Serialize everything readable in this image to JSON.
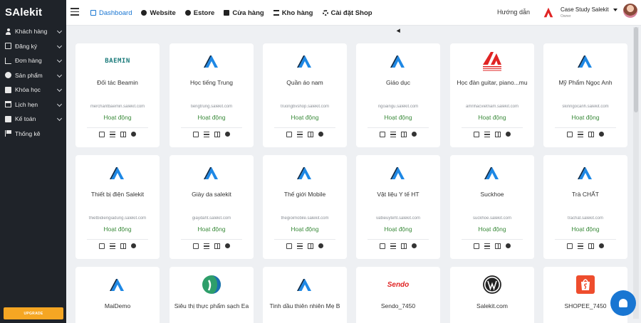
{
  "sidebar": {
    "brand": "SAlekit",
    "items": [
      {
        "label": "Khách hàng",
        "icon": "user-icon"
      },
      {
        "label": "Đăng ký",
        "icon": "register-icon"
      },
      {
        "label": "Đơn hàng",
        "icon": "cart-icon"
      },
      {
        "label": "Sản phẩm",
        "icon": "product-icon"
      },
      {
        "label": "Khóa học",
        "icon": "book-icon"
      },
      {
        "label": "Lịch hẹn",
        "icon": "calendar-icon"
      },
      {
        "label": "Kế toán",
        "icon": "calculator-icon"
      },
      {
        "label": "Thống kê",
        "icon": "flag-icon"
      }
    ],
    "upgrade_label": "UPGRADE"
  },
  "topbar": {
    "nav": [
      {
        "label": "Dashboard",
        "icon": "monitor-icon",
        "active": true
      },
      {
        "label": "Website",
        "icon": "globe-icon"
      },
      {
        "label": "Estore",
        "icon": "globe-icon"
      },
      {
        "label": "Cửa hàng",
        "icon": "store-icon"
      },
      {
        "label": "Kho hàng",
        "icon": "stack-icon"
      },
      {
        "label": "Cài đặt Shop",
        "icon": "gear-icon"
      }
    ],
    "guide": "Hướng dẫn",
    "account_name": "Case Study Salekit",
    "account_role": "Owner"
  },
  "colors": {
    "accent": "#1976d2",
    "status_green": "#3a8a3a",
    "sidebar_bg": "#1f2329",
    "upgrade": "#f5a623"
  },
  "cards": [
    {
      "name": "Đối tác Beamin",
      "domain": "merchantbaemin.salekit.com",
      "status": "Hoạt động",
      "logo": "beamin"
    },
    {
      "name": "Học tiếng Trung",
      "domain": "tiengtrung.salekit.com",
      "status": "Hoạt động",
      "logo": "salekit"
    },
    {
      "name": "Quần áo nam",
      "domain": "truongbvshop.salekit.com",
      "status": "Hoạt động",
      "logo": "salekit"
    },
    {
      "name": "Giáo dục",
      "domain": "ngoaingu.salekit.com",
      "status": "Hoạt động",
      "logo": "salekit"
    },
    {
      "name": "Học đàn guitar, piano...mu",
      "domain": "amnhacvietnam.salekit.com",
      "status": "Hoạt động",
      "logo": "red-a"
    },
    {
      "name": "Mỹ Phẩm Ngọc Anh",
      "domain": "skinngocanh.salekit.com",
      "status": "Hoạt động",
      "logo": "salekit"
    },
    {
      "name": "Thiết bị điện Salekit",
      "domain": "thietbidiengiadung.salekit.com",
      "status": "Hoạt động",
      "logo": "salekit"
    },
    {
      "name": "Giày da salekit",
      "domain": "giaydaht.salekit.com",
      "status": "Hoạt động",
      "logo": "salekit"
    },
    {
      "name": "Thế giới Mobile",
      "domain": "thegioimobile.salekit.com",
      "status": "Hoạt động",
      "logo": "salekit"
    },
    {
      "name": "Vật liệu Y tế HT",
      "domain": "vatlieuyteht.salekit.com",
      "status": "Hoạt động",
      "logo": "salekit"
    },
    {
      "name": "Suckhoe",
      "domain": "suckhoe.salekit.com",
      "status": "Hoạt động",
      "logo": "salekit"
    },
    {
      "name": "Trà CHẤT",
      "domain": "trachat.salekit.com",
      "status": "Hoạt động",
      "logo": "salekit"
    },
    {
      "name": "MaiDemo",
      "domain": "",
      "status": "",
      "logo": "salekit"
    },
    {
      "name": "Siêu thị thực phẩm sạch Ea",
      "domain": "",
      "status": "",
      "logo": "green-circle"
    },
    {
      "name": "Tinh dầu thiên nhiên Mẹ B",
      "domain": "",
      "status": "",
      "logo": "salekit"
    },
    {
      "name": "Sendo_7450",
      "domain": "",
      "status": "",
      "logo": "sendo"
    },
    {
      "name": "Salekit.com",
      "domain": "",
      "status": "",
      "logo": "wordpress"
    },
    {
      "name": "SHOPEE_7450",
      "domain": "",
      "status": "",
      "logo": "shopee"
    }
  ],
  "logo_texts": {
    "beamin": "BAEMIN",
    "sendo": "Sendo"
  }
}
